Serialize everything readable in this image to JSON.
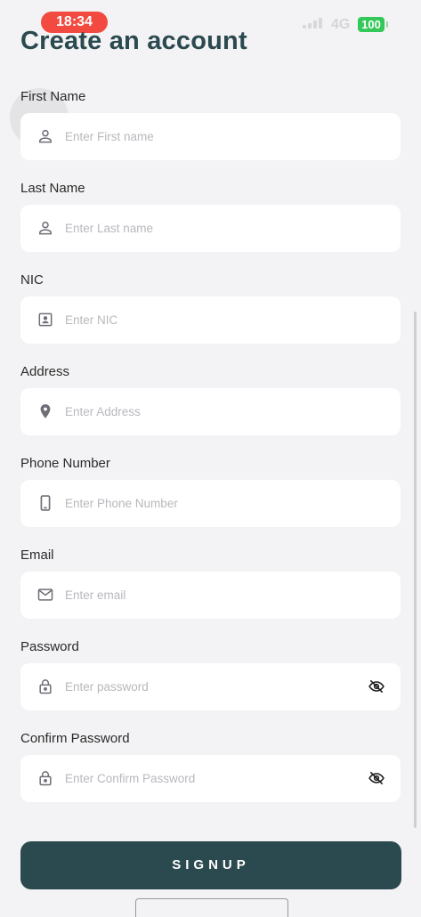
{
  "status_bar": {
    "time": "18:34",
    "network": "4G",
    "battery": "100",
    "colors": {
      "time_pill": "#f24a40",
      "battery": "#34c759"
    }
  },
  "page": {
    "title": "Create an account"
  },
  "form": {
    "fields": [
      {
        "label": "First Name",
        "placeholder": "Enter First name",
        "icon": "person-icon"
      },
      {
        "label": "Last Name",
        "placeholder": "Enter Last name",
        "icon": "person-icon"
      },
      {
        "label": "NIC",
        "placeholder": "Enter NIC",
        "icon": "id-card-icon"
      },
      {
        "label": "Address",
        "placeholder": "Enter Address",
        "icon": "location-pin-icon"
      },
      {
        "label": "Phone Number",
        "placeholder": "Enter Phone Number",
        "icon": "phone-icon"
      },
      {
        "label": "Email",
        "placeholder": "Enter email",
        "icon": "mail-icon"
      },
      {
        "label": "Password",
        "placeholder": "Enter password",
        "icon": "lock-icon",
        "toggle_icon": "eye-off-icon"
      },
      {
        "label": "Confirm Password",
        "placeholder": "Enter Confirm Password",
        "icon": "lock-icon",
        "toggle_icon": "eye-off-icon"
      }
    ]
  },
  "actions": {
    "signup_label": "SIGNUP"
  },
  "theme": {
    "primary": "#2b4a4f",
    "background": "#f3f2f4",
    "field_bg": "#ffffff"
  }
}
